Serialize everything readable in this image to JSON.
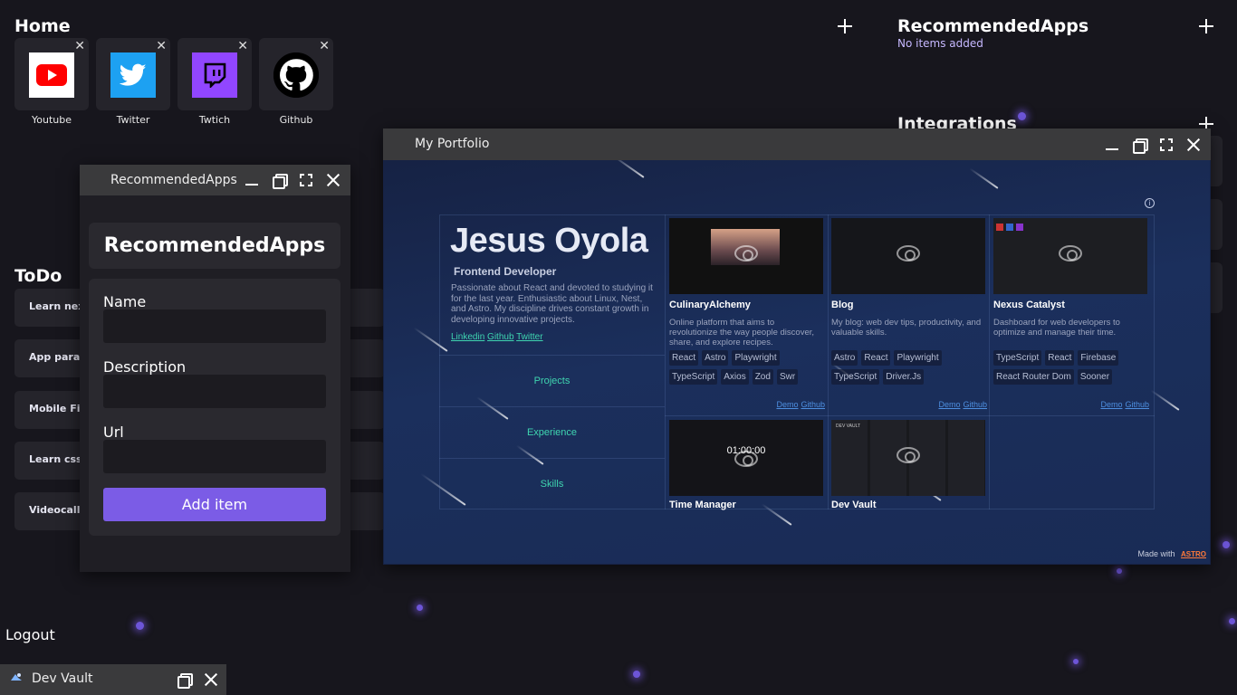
{
  "desktop": {
    "home": {
      "title": "Home",
      "apps": [
        {
          "label": "Youtube",
          "icon": "youtube-icon",
          "color": "#ff0000"
        },
        {
          "label": "Twitter",
          "icon": "twitter-icon",
          "color": "#1da1f2"
        },
        {
          "label": "Twtich",
          "icon": "twitch-icon",
          "color": "#9146ff"
        },
        {
          "label": "Github",
          "icon": "github-icon",
          "color": "#000000"
        }
      ]
    },
    "recommended": {
      "title": "RecommendedApps",
      "empty_text": "No items added"
    },
    "integrations": {
      "title": "Integrations"
    },
    "todo": {
      "title": "ToDo",
      "items": [
        "Learn next",
        "App para g",
        "Mobile Firs",
        "Learn css v",
        "Videocalls"
      ]
    },
    "logout_label": "Logout"
  },
  "recommended_window": {
    "title": "RecommendedApps",
    "heading": "RecommendedApps",
    "fields": [
      {
        "label": "Name",
        "value": ""
      },
      {
        "label": "Description",
        "value": ""
      },
      {
        "label": "Url",
        "value": ""
      }
    ],
    "submit_label": "Add item",
    "accent": "#7b5ce6"
  },
  "portfolio_window": {
    "title": "My Portfolio",
    "name": "Jesus Oyola",
    "role": "Frontend Developer",
    "bio": "Passionate about React and devoted to studying it for the last year. Enthusiastic about Linux, Nest, and Astro. My discipline drives constant growth in developing innovative projects.",
    "social_links": [
      "Linkedin",
      "Github",
      "Twitter"
    ],
    "nav": [
      "Projects",
      "Experience",
      "Skills"
    ],
    "projects": [
      {
        "title": "CulinaryAlchemy",
        "description": "Online platform that aims to revolutionize the way people discover, share, and explore recipes.",
        "tags": [
          "React",
          "Astro",
          "Playwright",
          "TypeScript",
          "Axios",
          "Zod",
          "Swr"
        ],
        "links": [
          "Demo",
          "Github"
        ]
      },
      {
        "title": "Blog",
        "description": "My blog: web dev tips, productivity, and valuable skills.",
        "tags": [
          "Astro",
          "React",
          "Playwright",
          "TypeScript",
          "Driver.Js"
        ],
        "links": [
          "Demo",
          "Github"
        ]
      },
      {
        "title": "Nexus Catalyst",
        "description": "Dashboard for web developers to optimize and manage their time.",
        "tags": [
          "TypeScript",
          "React",
          "Firebase",
          "React Router Dom",
          "Sooner"
        ],
        "links": [
          "Demo",
          "Github"
        ]
      },
      {
        "title": "Time Manager",
        "preview_text": "01:00:00"
      },
      {
        "title": "Dev Vault",
        "preview_text": "DEV VAULT"
      }
    ],
    "footer_text": "Made with",
    "footer_brand": "ASTRO",
    "link_color": "#4d8fe0",
    "nav_color": "#3fd5b0"
  },
  "taskbar": {
    "items": [
      {
        "label": "Dev Vault",
        "icon": "dev-vault-icon"
      }
    ]
  }
}
